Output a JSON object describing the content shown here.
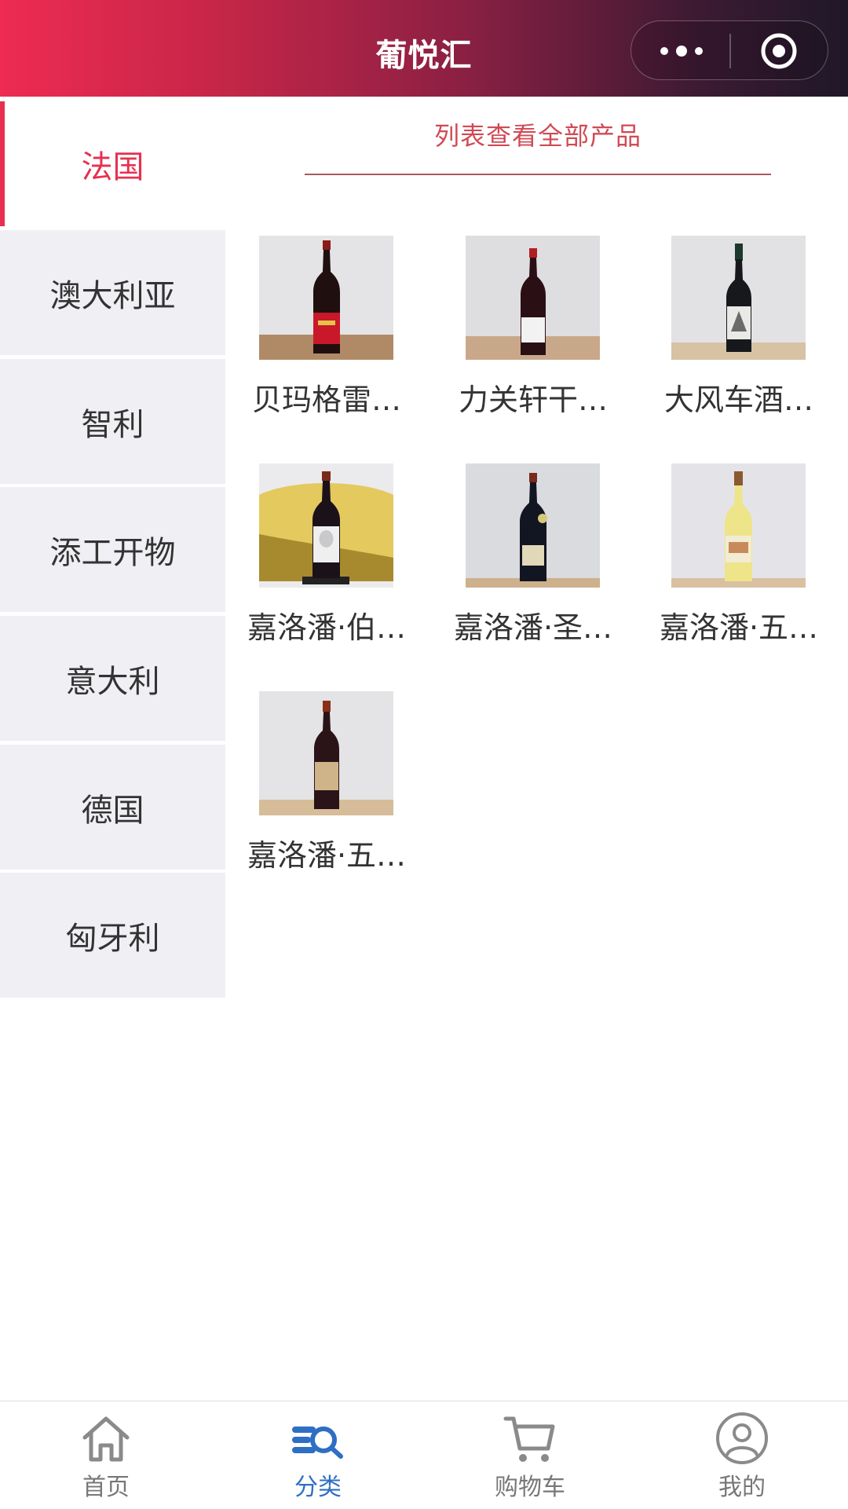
{
  "header": {
    "title": "葡悦汇"
  },
  "sidebar": {
    "items": [
      {
        "label": "法国",
        "active": true
      },
      {
        "label": "澳大利亚",
        "active": false
      },
      {
        "label": "智利",
        "active": false
      },
      {
        "label": "添工开物",
        "active": false
      },
      {
        "label": "意大利",
        "active": false
      },
      {
        "label": "德国",
        "active": false
      },
      {
        "label": "匈牙利",
        "active": false
      }
    ]
  },
  "main": {
    "view_all_label": "列表查看全部产品",
    "products": [
      {
        "name": "贝玛格雷…"
      },
      {
        "name": "力关轩干…"
      },
      {
        "name": "大风车酒…"
      },
      {
        "name": "嘉洛潘·伯…"
      },
      {
        "name": "嘉洛潘·圣…"
      },
      {
        "name": "嘉洛潘·五…"
      },
      {
        "name": "嘉洛潘·五…"
      }
    ]
  },
  "tabbar": {
    "tabs": [
      {
        "label": "首页",
        "icon": "home-icon",
        "active": false
      },
      {
        "label": "分类",
        "icon": "category-search-icon",
        "active": true
      },
      {
        "label": "购物车",
        "icon": "cart-icon",
        "active": false
      },
      {
        "label": "我的",
        "icon": "user-icon",
        "active": false
      }
    ]
  },
  "colors": {
    "accent": "#e7304f",
    "tab_active": "#2e6fc4",
    "sidebar_bg": "#efeff4"
  }
}
